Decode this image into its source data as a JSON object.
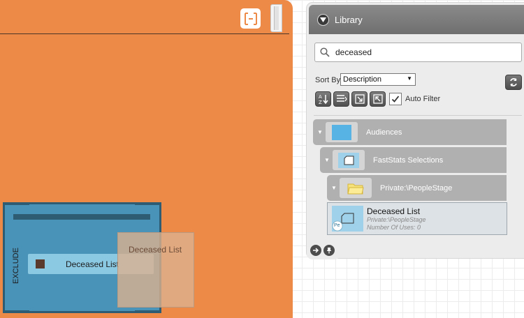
{
  "canvas": {
    "exclude_label": "EXCLUDE",
    "chip_label": "Deceased List",
    "drag_ghost_label": "Deceased List"
  },
  "library": {
    "title": "Library",
    "search": {
      "value": "deceased"
    },
    "sort_by_label": "Sort By",
    "sort_value": "Description",
    "auto_filter_label": "Auto Filter",
    "auto_filter_checked": true,
    "tree": {
      "audiences": "Audiences",
      "selections": "FastStats Selections",
      "folder": "Private:\\PeopleStage"
    },
    "result": {
      "title": "Deceased List",
      "path": "Private:\\PeopleStage",
      "uses": "Number Of Uses: 0",
      "badge": "Pe"
    }
  },
  "colors": {
    "canvas": "#ee8a48",
    "exclude_block": "#4a93b8",
    "chip": "#8bc9e3",
    "library_bg": "#ececec",
    "tree_node": "#b0b0b0"
  }
}
